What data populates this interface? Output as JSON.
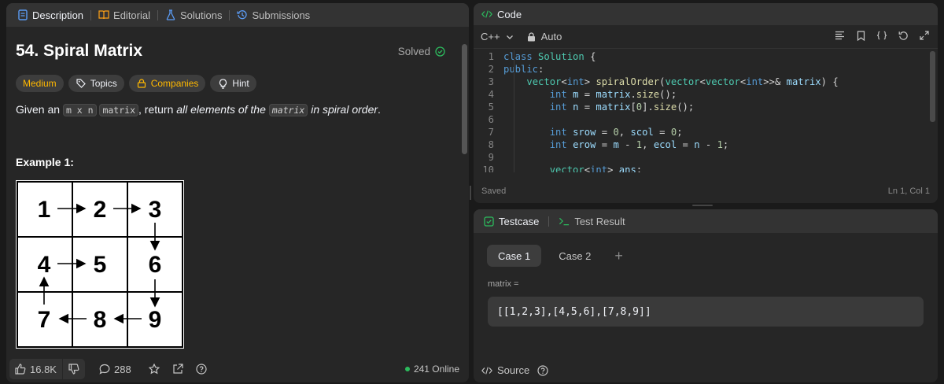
{
  "left_tabs": [
    {
      "label": "Description",
      "icon": "document-icon",
      "active": true
    },
    {
      "label": "Editorial",
      "icon": "book-icon",
      "active": false
    },
    {
      "label": "Solutions",
      "icon": "flask-icon",
      "active": false
    },
    {
      "label": "Submissions",
      "icon": "history-icon",
      "active": false
    }
  ],
  "problem": {
    "title": "54. Spiral Matrix",
    "status": "Solved",
    "chips": {
      "difficulty": "Medium",
      "topics": "Topics",
      "companies": "Companies",
      "hint": "Hint"
    },
    "statement": {
      "pre": "Given an ",
      "code1": "m x n",
      "mid1": " ",
      "code2": "matrix",
      "mid2": ", return ",
      "em1": "all elements of the ",
      "code3": "matrix",
      "em2": " in spiral order",
      "end": "."
    },
    "example_title": "Example 1:",
    "grid_numbers": [
      "1",
      "2",
      "3",
      "4",
      "5",
      "6",
      "7",
      "8",
      "9"
    ]
  },
  "footer": {
    "likes": "16.8K",
    "comments": "288",
    "online": "241 Online"
  },
  "code_panel": {
    "title": "Code",
    "language": "C++",
    "mode": "Auto",
    "status": "Saved",
    "cursor": "Ln 1, Col 1",
    "line_numbers": [
      "1",
      "2",
      "3",
      "4",
      "5",
      "6",
      "7",
      "8",
      "9",
      "10"
    ]
  },
  "test_panel": {
    "tab_active": "Testcase",
    "tab_other": "Test Result",
    "cases": [
      "Case 1",
      "Case 2"
    ],
    "param_label": "matrix =",
    "param_value": "[[1,2,3],[4,5,6],[7,8,9]]",
    "source": "Source"
  },
  "colors": {
    "accent_green": "#2cbb5d",
    "medium": "#ffb800",
    "panel": "#262626"
  }
}
